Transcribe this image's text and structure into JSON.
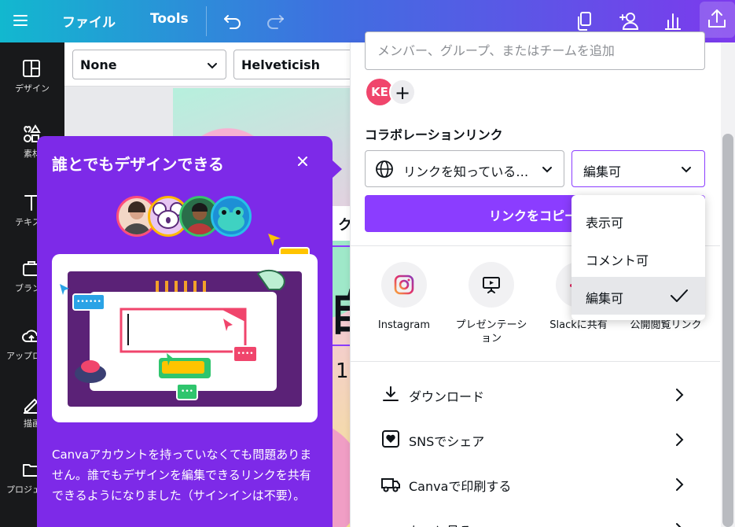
{
  "topbar": {
    "file_label": "ファイル",
    "tools_label": "Tools"
  },
  "sidebar": {
    "items": [
      {
        "label": "デザイン"
      },
      {
        "label": "素材"
      },
      {
        "label": "テキスト"
      },
      {
        "label": "ブランド"
      },
      {
        "label": "アップロード"
      },
      {
        "label": "描画"
      },
      {
        "label": "プロジェクト"
      }
    ]
  },
  "toolbar": {
    "style_value": "None",
    "font_value": "Helveticish"
  },
  "canvas": {
    "chip_text": "ク",
    "big_text": "自",
    "num_text": "1"
  },
  "popup": {
    "title": "誰とでもデザインできる",
    "body": "Canvaアカウントを持っていなくても問題ありません。誰でもデザインを編集できるリンクを共有できるようになりました（サインインは不要）。",
    "illustration": {
      "dots": "••••••",
      "dots_yellow": "•••••",
      "dots_red": "••••",
      "dots_green": "•••"
    }
  },
  "share": {
    "add_placeholder": "メンバー、グループ、またはチームを追加",
    "member_initials": "KE",
    "add_member_symbol": "+",
    "collab_title": "コラボレーションリンク",
    "link_access_value": "リンクを知っている…",
    "permission_value": "編集可",
    "copy_button": "リンクをコピー",
    "options": [
      {
        "label": "Instagram",
        "icon": "instagram-icon"
      },
      {
        "label": "プレゼンテーション",
        "icon": "presentation-icon"
      },
      {
        "label": "Slackに共有",
        "icon": "slack-icon"
      },
      {
        "label": "公開閲覧リンク",
        "icon": "link-icon"
      }
    ],
    "rows": [
      {
        "label": "ダウンロード",
        "icon": "download-icon"
      },
      {
        "label": "SNSでシェア",
        "icon": "heart-icon"
      },
      {
        "label": "Canvaで印刷する",
        "icon": "truck-icon"
      },
      {
        "label": "もっと見る",
        "icon": "more-icon"
      }
    ]
  },
  "permission_dropdown": {
    "options": [
      "表示可",
      "コメント可",
      "編集可"
    ],
    "selected": "編集可"
  },
  "colors": {
    "accent": "#8b3dff",
    "popup": "#7d2ae8",
    "avatar_ke": "#f0456c"
  }
}
